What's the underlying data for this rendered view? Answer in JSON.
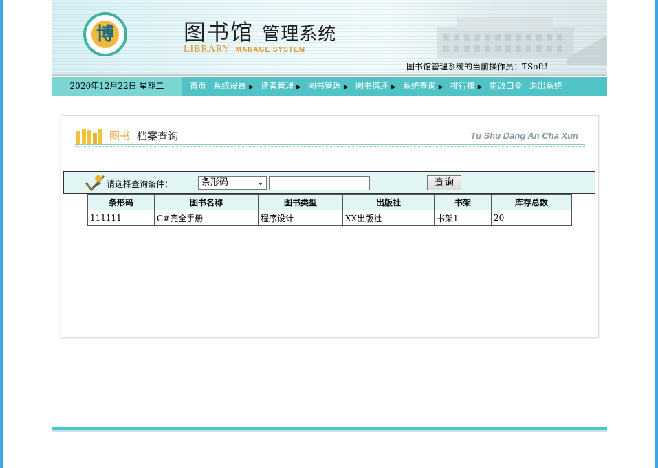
{
  "header": {
    "logo_char": "博",
    "title_main": "图书馆",
    "title_sub": "管理系统",
    "title_en": "LIBRARY",
    "title_en_small": "MANAGE SYSTEM",
    "operator_text": "图书馆管理系统的当前操作员：TSoft!"
  },
  "nav": {
    "date": "2020年12月22日  星期二",
    "items": [
      {
        "label": "首页",
        "has_arrow": false
      },
      {
        "label": "系统设置",
        "has_arrow": true
      },
      {
        "label": "读者管理",
        "has_arrow": true
      },
      {
        "label": "图书管理",
        "has_arrow": true
      },
      {
        "label": "图书借还",
        "has_arrow": true
      },
      {
        "label": "系统查询",
        "has_arrow": true
      },
      {
        "label": "排行榜",
        "has_arrow": true
      },
      {
        "label": "更改口令",
        "has_arrow": false
      },
      {
        "label": "退出系统",
        "has_arrow": false
      }
    ]
  },
  "section": {
    "title_highlight": "图书",
    "title_rest": "档案查询",
    "pinyin": "Tu Shu Dang An Cha Xun"
  },
  "query": {
    "label": "请选择查询条件：",
    "selected_option": "条形码",
    "input_value": "",
    "button_label": "查询"
  },
  "table": {
    "headers": [
      "条形码",
      "图书名称",
      "图书类型",
      "出版社",
      "书架",
      "库存总数"
    ],
    "rows": [
      [
        "111111",
        "C#完全手册",
        "程序设计",
        "XX出版社",
        "书架1",
        "20"
      ]
    ]
  },
  "colors": {
    "accent": "#4fc3c5",
    "header_cell": "#e1f5f5",
    "side_edge": "#3aa6e8"
  }
}
